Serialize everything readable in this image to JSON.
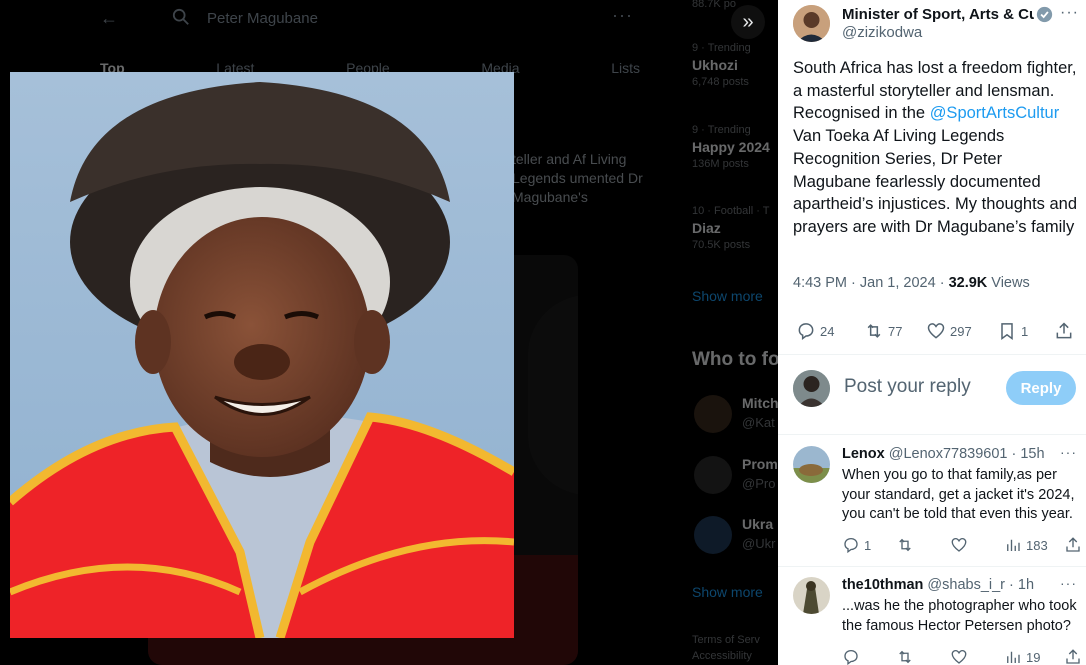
{
  "background": {
    "search_text": "Peter Magubane",
    "tabs": [
      "Top",
      "Latest",
      "People",
      "Media",
      "Lists"
    ],
    "post_excerpt": "teller and Af Living Legends umented Dr Magubane's",
    "trends": [
      {
        "meta": "9 · Trending",
        "name": "Ukhozi",
        "count": "6,748 posts"
      },
      {
        "meta": "9 · Trending",
        "name": "Happy 2024",
        "count": "136M posts"
      },
      {
        "meta": "10 · Football · T",
        "name": "Diaz",
        "count": "70.5K posts"
      }
    ],
    "top_count": "88.7K po",
    "show_more_1": "Show more",
    "who_to_follow": "Who to fo",
    "follow": [
      {
        "name": "Mitch",
        "handle": "@Kat"
      },
      {
        "name": "Prom",
        "handle": "@Pro"
      },
      {
        "name": "Ukra",
        "handle": "@Ukr"
      }
    ],
    "show_more_2": "Show more",
    "footer": [
      "Terms of Serv",
      "Accessibility"
    ]
  },
  "tweet": {
    "author_name": "Minister of Sport, Arts & Culture",
    "handle": "@zizikodwa",
    "text_before": "South Africa has lost a freedom fighter, a masterful storyteller and lensman. Recognised in the ",
    "mention": "@SportArtsCultur",
    "text_after": " Van Toeka Af Living Legends Recognition Series, Dr Peter Magubane fearlessly documented apartheid’s injustices. My thoughts and prayers are with Dr Magubane’s family",
    "time": "4:43 PM · Jan 1, 2024 · ",
    "views_count": "32.9K",
    "views_label": " Views",
    "replies": "24",
    "retweets": "77",
    "likes": "297",
    "bookmarks": "1"
  },
  "reply_box": {
    "placeholder": "Post your reply",
    "button": "Reply"
  },
  "replies": [
    {
      "name": "Lenox",
      "handle": "@Lenox77839601",
      "time": " · 15h",
      "text": "When you go to that family,as per your standard, get a jacket it's 2024, you can't be told that even this year.",
      "replies": "1",
      "retweets": "",
      "likes": "",
      "views": "183"
    },
    {
      "name": "the10thman",
      "handle": "@shabs_i_r",
      "time": " · 1h",
      "text": "...was he the photographer who took the famous Hector Petersen photo?",
      "replies": "",
      "retweets": "",
      "likes": "",
      "views": "19"
    }
  ],
  "colors": {
    "accent": "#1d9bf0",
    "reply_button": "#8ecdf8",
    "gown_red": "#ee2328",
    "gown_trim": "#f2b830",
    "photo_sky": "#9ab7d2"
  }
}
